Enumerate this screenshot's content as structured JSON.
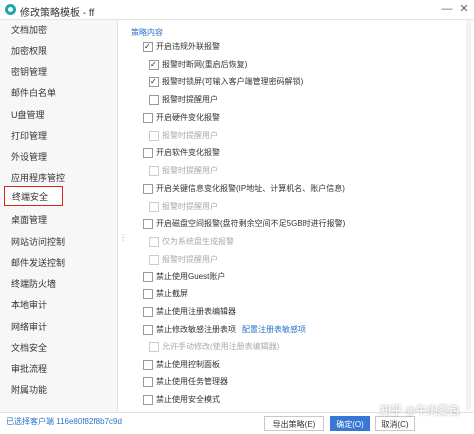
{
  "window": {
    "title": "修改策略模板 - ff",
    "min_icon": "minimize-icon",
    "close_icon": "close-icon"
  },
  "sidebar": {
    "items": [
      {
        "label": "文档加密"
      },
      {
        "label": "加密权限"
      },
      {
        "label": "密钥管理"
      },
      {
        "label": "邮件白名单"
      },
      {
        "label": "U盘管理"
      },
      {
        "label": "打印管理"
      },
      {
        "label": "外设管理"
      },
      {
        "label": "应用程序管控"
      },
      {
        "label": "终端安全",
        "active": true
      },
      {
        "label": "桌面管理"
      },
      {
        "label": "网站访问控制"
      },
      {
        "label": "邮件发送控制"
      },
      {
        "label": "终端防火墙"
      },
      {
        "label": "本地审计"
      },
      {
        "label": "网络审计"
      },
      {
        "label": "文档安全"
      },
      {
        "label": "审批流程"
      },
      {
        "label": "附属功能"
      }
    ]
  },
  "main": {
    "section_title": "策略内容",
    "options": [
      {
        "label": "开启违规外联报警",
        "checked": true,
        "disabled": false
      },
      {
        "label": "报警时断网(重启后恢复)",
        "checked": true,
        "disabled": false
      },
      {
        "label": "报警时锁屏(可输入客户端管理密码解锁)",
        "checked": true,
        "disabled": false
      },
      {
        "label": "报警时提醒用户",
        "checked": false,
        "disabled": false
      },
      {
        "label": "开启硬件变化报警",
        "checked": false,
        "disabled": false
      },
      {
        "label": "报警时提醒用户",
        "checked": false,
        "disabled": true
      },
      {
        "label": "开启软件变化报警",
        "checked": false,
        "disabled": false
      },
      {
        "label": "报警时提醒用户",
        "checked": false,
        "disabled": true
      },
      {
        "label": "开启关键信息变化报警(IP地址、计算机名、账户信息)",
        "checked": false,
        "disabled": false
      },
      {
        "label": "报警时提醒用户",
        "checked": false,
        "disabled": true
      },
      {
        "label": "开启磁盘空间报警(盘符剩余空间不足5GB时进行报警)",
        "checked": false,
        "disabled": false
      },
      {
        "label": "仅为系统盘生成报警",
        "checked": false,
        "disabled": true
      },
      {
        "label": "报警时提醒用户",
        "checked": false,
        "disabled": true
      },
      {
        "label": "禁止使用Guest账户",
        "checked": false,
        "disabled": false
      },
      {
        "label": "禁止截屏",
        "checked": false,
        "disabled": false
      },
      {
        "label": "禁止使用注册表编辑器",
        "checked": false,
        "disabled": false
      },
      {
        "label": "禁止修改敏感注册表项",
        "checked": false,
        "disabled": false,
        "link": "配置注册表敏感项"
      },
      {
        "label": "允许手动修改(使用注册表编辑器)",
        "checked": false,
        "disabled": true
      },
      {
        "label": "禁止使用控制面板",
        "checked": false,
        "disabled": false
      },
      {
        "label": "禁止使用任务管理器",
        "checked": false,
        "disabled": false
      },
      {
        "label": "禁止使用安全模式",
        "checked": false,
        "disabled": false
      }
    ]
  },
  "footer": {
    "status": "已选择客户端 116e80f82f8b7c9d",
    "export_label": "导出策略(E)",
    "ok_label": "确定(O)",
    "cancel_label": "取消(C)",
    "watermark": "知乎 @牛肉蒸包"
  },
  "colors": {
    "accent": "#2a73c8",
    "active_border": "#d9251d",
    "primary_button": "#3977d6"
  }
}
